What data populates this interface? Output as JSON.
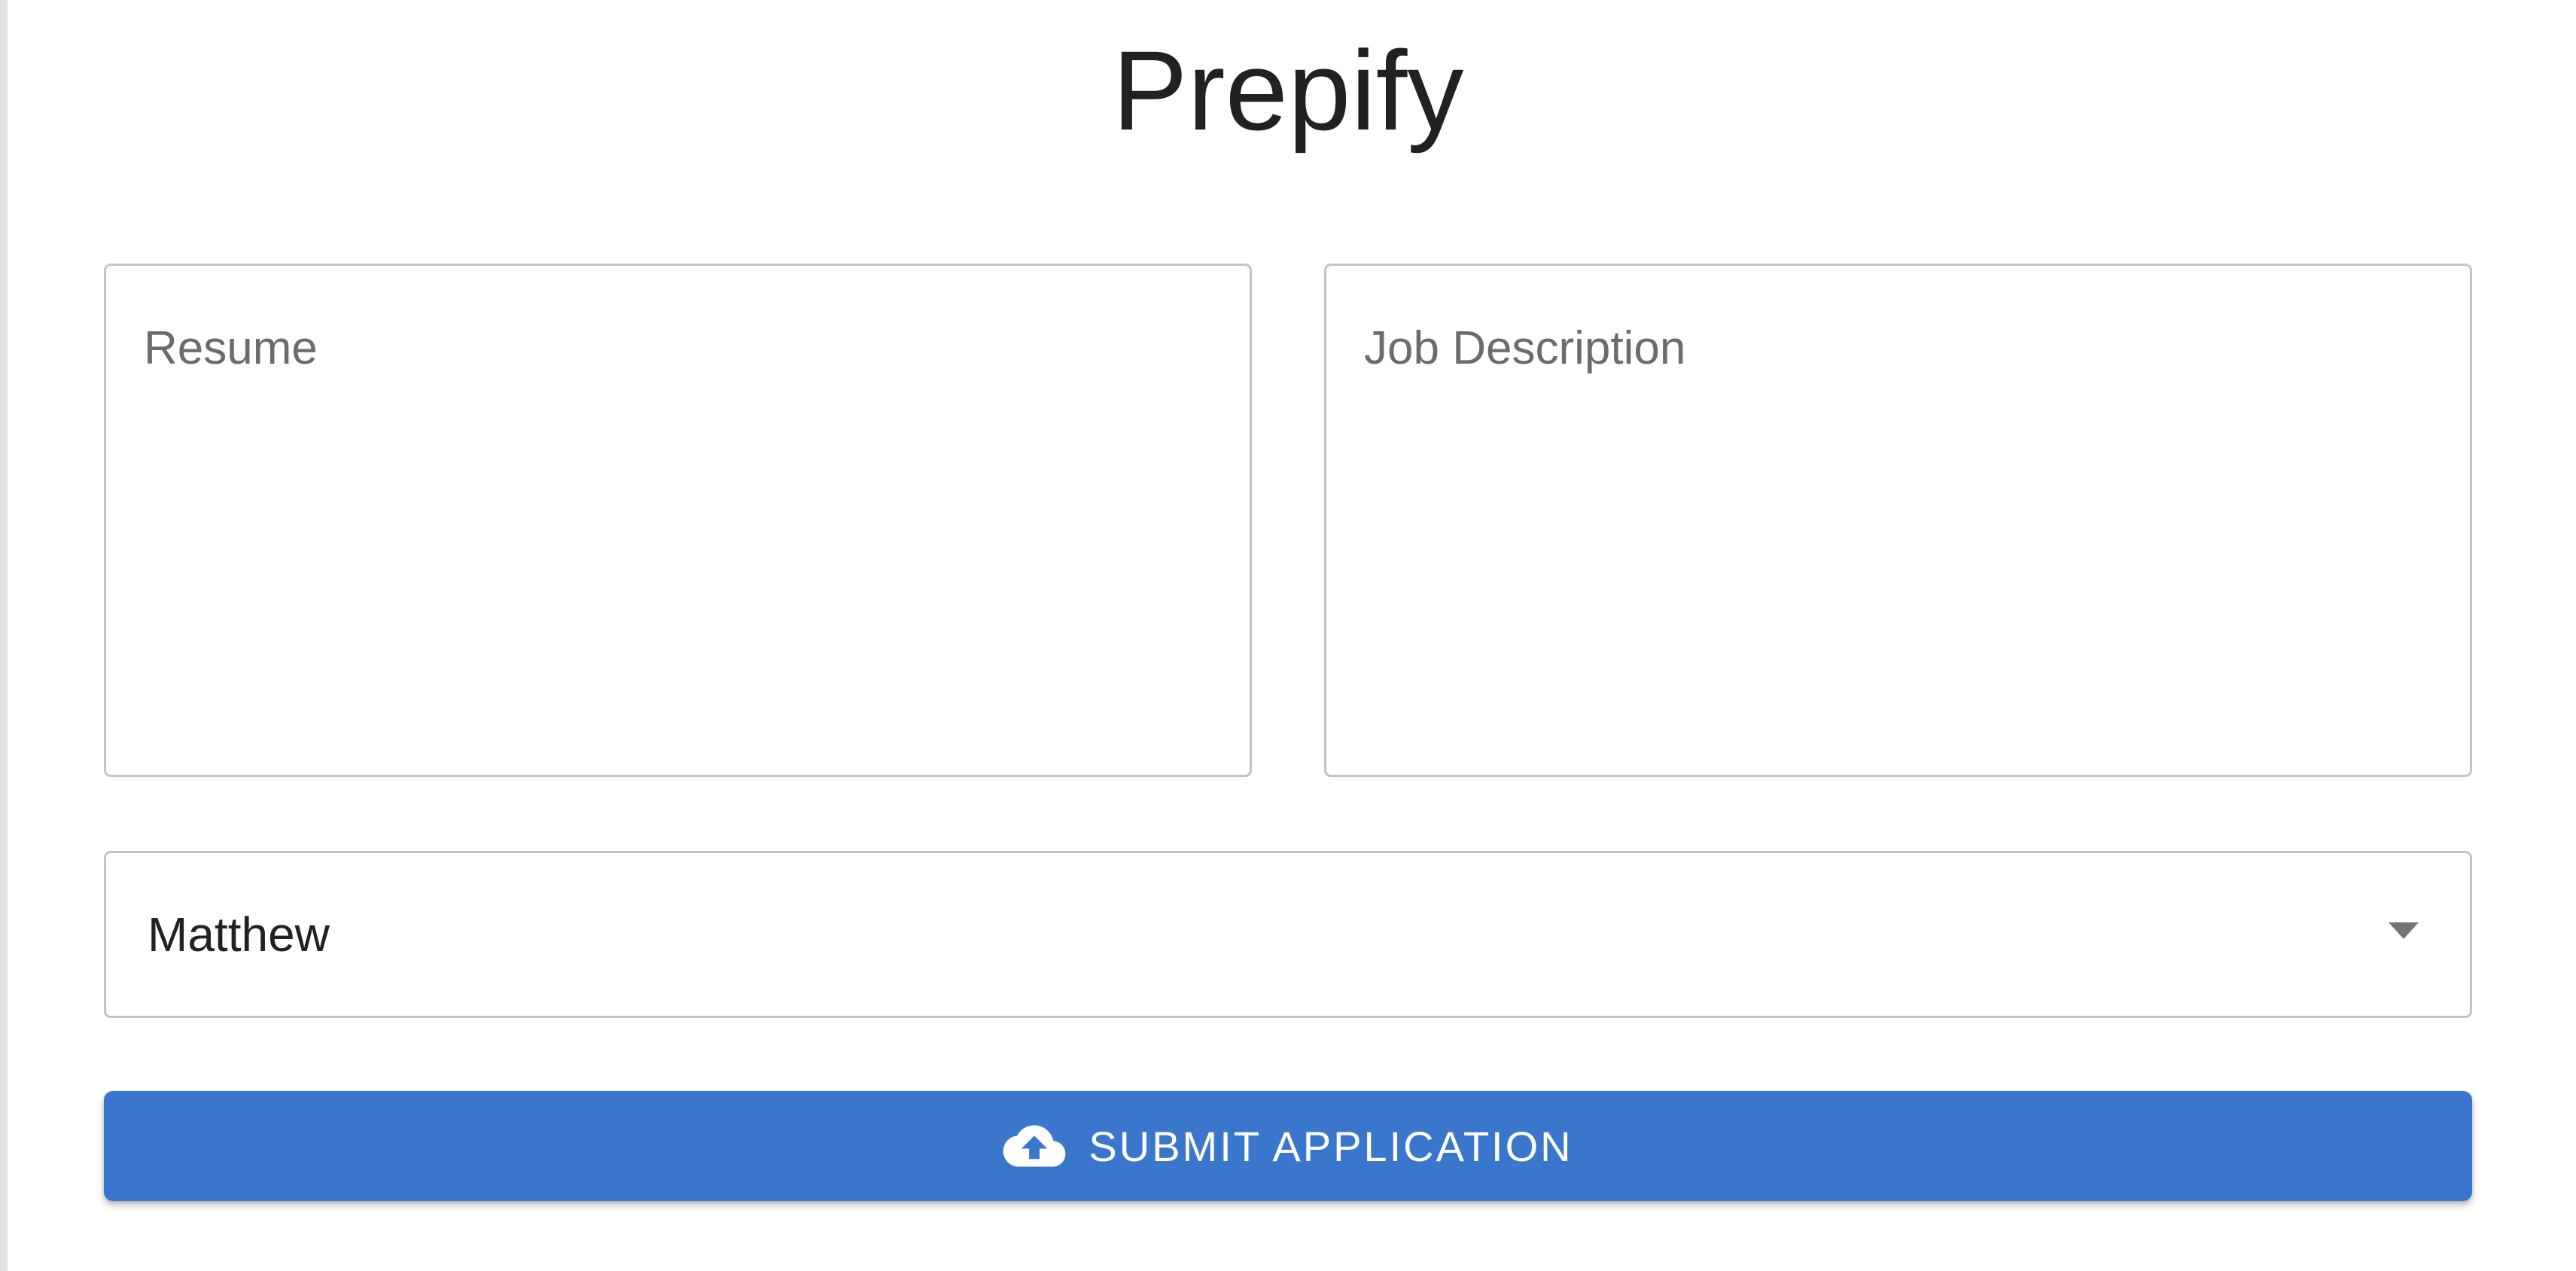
{
  "app": {
    "title": "Prepify"
  },
  "form": {
    "resume": {
      "placeholder": "Resume",
      "value": ""
    },
    "job_description": {
      "placeholder": "Job Description",
      "value": ""
    },
    "name_select": {
      "selected": "Matthew"
    },
    "submit": {
      "label": "SUBMIT APPLICATION",
      "icon": "cloud-upload-icon"
    }
  },
  "colors": {
    "primary": "#3a76cc",
    "border": "#c4c4c4",
    "text": "#212121",
    "placeholder": "#6b6b6b"
  }
}
